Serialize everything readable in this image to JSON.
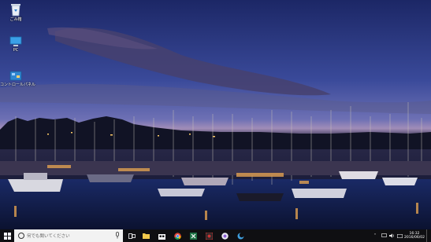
{
  "desktop": {
    "icons": [
      {
        "label": "ごみ箱",
        "icon": "recycle-bin-icon"
      },
      {
        "label": "PC",
        "icon": "computer-icon"
      },
      {
        "label": "コントロールパネル",
        "icon": "control-panel-icon"
      }
    ]
  },
  "taskbar": {
    "search_placeholder": "何でも聞いてください",
    "apps": [
      "task-view-icon",
      "file-explorer-icon",
      "store-icon",
      "chrome-icon",
      "excel-icon",
      "media-icon",
      "app-icon",
      "app-icon"
    ],
    "time": "16:32",
    "date": "2016/06/02"
  },
  "colors": {
    "taskbar_bg": "#0f0f12",
    "sky_top": "#1d2a6b",
    "sky_bottom": "#8a7ab8"
  }
}
